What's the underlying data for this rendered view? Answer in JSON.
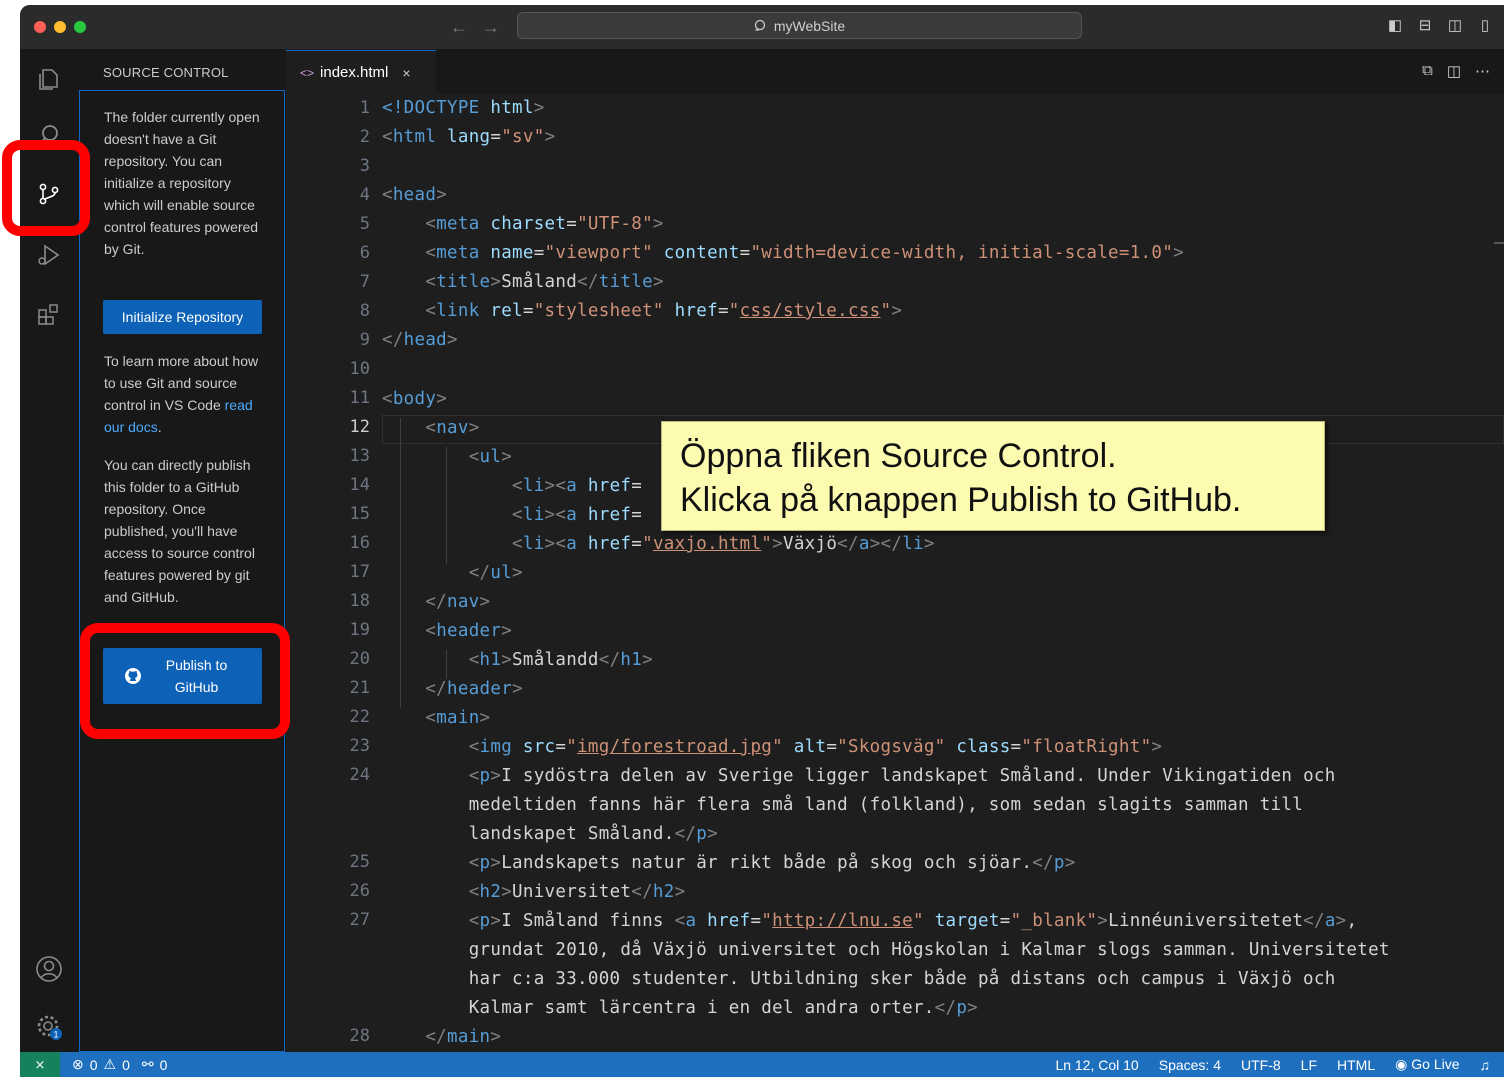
{
  "titlebar": {
    "search_text": "myWebSite",
    "back_arrow": "←",
    "forward_arrow": "→"
  },
  "activity_bar": {
    "icons": [
      "files-icon",
      "search-icon",
      "source-control-icon",
      "run-debug-icon",
      "extensions-icon",
      "account-icon",
      "settings-gear-icon"
    ],
    "settings_badge": "1"
  },
  "sidebar": {
    "title": "SOURCE CONTROL",
    "intro_text": "The folder currently open doesn't have a Git repository. You can initialize a repository which will enable source control features powered by Git.",
    "init_button": "Initialize Repository",
    "learn_text": "To learn more about how to use Git and source control in VS Code ",
    "learn_link": "read our docs",
    "learn_suffix": ".",
    "publish_text": "You can directly publish this folder to a GitHub repository. Once published, you'll have access to source control features powered by git and GitHub.",
    "publish_button": "Publish to GitHub"
  },
  "tabs": [
    {
      "label": "index.html",
      "icon": "<>",
      "close": "×"
    }
  ],
  "editor": {
    "current_line": 12,
    "line_numbers": [
      "1",
      "2",
      "3",
      "4",
      "5",
      "6",
      "7",
      "8",
      "9",
      "10",
      "11",
      "12",
      "13",
      "14",
      "15",
      "16",
      "17",
      "18",
      "19",
      "20",
      "21",
      "22",
      "23",
      "24",
      "",
      "",
      "25",
      "26",
      "27",
      "",
      "",
      "",
      "28"
    ],
    "lines": {
      "l1a": "<!DOCTYPE",
      "l1b": " html",
      "l1c": ">",
      "l2a": "<",
      "l2b": "html",
      "l2c": " lang",
      "l2d": "=",
      "l2e": "\"sv\"",
      "l2f": ">",
      "l4a": "<",
      "l4b": "head",
      "l4c": ">",
      "l5b": "meta",
      "l5c": " charset",
      "l5e": "\"UTF-8\"",
      "l6b": "meta",
      "l6c": " name",
      "l6e": "\"viewport\"",
      "l6g": " content",
      "l6i": "\"width=device-width, initial-scale=1.0\"",
      "l7b": "title",
      "l7t": "Småland",
      "l7c": "</",
      "l7d": "title",
      "l8b": "link",
      "l8c": " rel",
      "l8e": "\"stylesheet\"",
      "l8g": " href",
      "l8h": "\"",
      "l8i": "css/style.css",
      "l8j": "\"",
      "l9b": "head",
      "l11b": "body",
      "l12b": "nav",
      "l13b": "ul",
      "l14": "li",
      "l14a": "a",
      "l14h": " href",
      "l16h": " href",
      "l16q": "\"",
      "l16u": "vaxjo.html",
      "l16q2": "\"",
      "l16t": "Växjö",
      "l17b": "ul",
      "l18b": "nav",
      "l19b": "header",
      "l20b": "h1",
      "l20t": "Smålandd",
      "l21b": "header",
      "l22b": "main",
      "l23b": "img",
      "l23c": " src",
      "l23q": "\"",
      "l23u": "img/forestroad.jpg",
      "l23q2": "\"",
      "l23d": " alt",
      "l23e": "\"Skogsväg\"",
      "l23f": " class",
      "l23g": "\"floatRight\"",
      "l24b": "p",
      "l24t1": "I sydöstra delen av Sverige ligger landskapet Småland. Under Vikingatiden och",
      "l24t2": "medeltiden fanns här flera små land (folkland), som sedan slagits samman till",
      "l24t3": "landskapet Småland.",
      "l25b": "p",
      "l25t": "Landskapets natur är rikt både på skog och sjöar.",
      "l26b": "h2",
      "l26t": "Universitet",
      "l27b": "p",
      "l27t": "I Småland finns ",
      "l27a": "a",
      "l27h": " href",
      "l27u": "http://lnu.se",
      "l27tg": " target",
      "l27tv": "\"_blank\"",
      "l27lt": "Linnéuniversitetet",
      "l27end": ",",
      "l27t2": "grundat 2010, då Växjö universitet och Högskolan i Kalmar slogs samman. Universitetet",
      "l27t3": "har c:a 33.000 studenter. Utbildning sker både på distans och campus i Växjö och",
      "l27t4": "Kalmar samt lärcentra i en del andra orter.",
      "l28b": "main"
    }
  },
  "callout": {
    "line1": "Öppna fliken Source Control.",
    "line2": "Klicka på knappen Publish to GitHub."
  },
  "statusbar": {
    "remote": "⨯",
    "errors": "0",
    "warnings": "0",
    "ports": "0",
    "position": "Ln 12, Col 10",
    "spaces": "Spaces: 4",
    "encoding": "UTF-8",
    "eol": "LF",
    "language": "HTML",
    "golive": "Go Live"
  },
  "colors": {
    "accent": "#0e66c6",
    "status_bar": "#1f6fbf",
    "highlight_ring": "#ff0000",
    "callout_bg": "#fdfbb0"
  }
}
